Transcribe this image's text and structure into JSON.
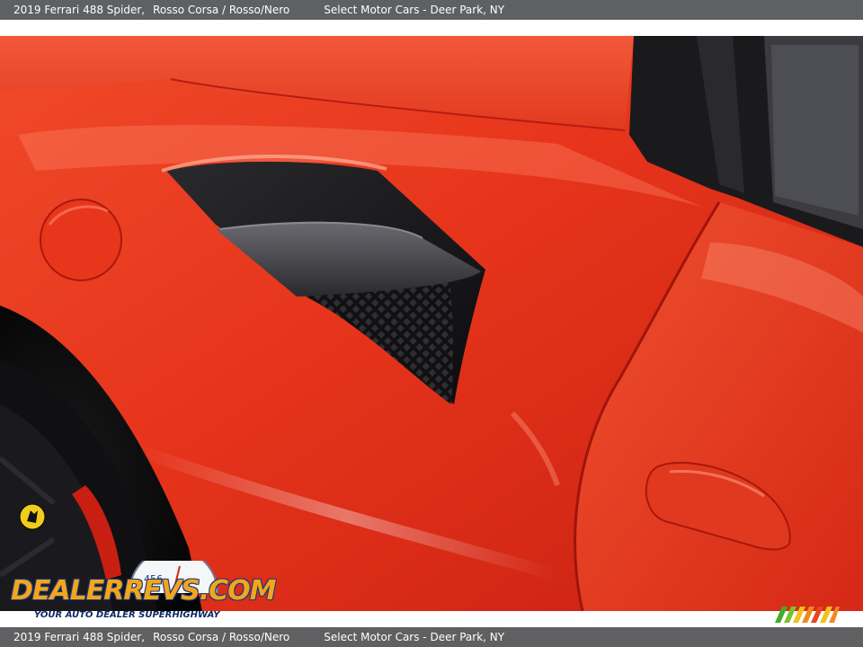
{
  "caption": {
    "title": "2019 Ferrari 488 Spider,",
    "colors": "Rosso Corsa / Rosso/Nero",
    "dealer": "Select Motor Cars - Deer Park, NY"
  },
  "photo": {
    "description_icon": "car-photo",
    "body_color": "#e8321a"
  },
  "watermark": {
    "logo_text": "DEALERREVS.COM",
    "tagline": "YOUR AUTO DEALER SUPERHIGHWAY",
    "gauge_digits": "456"
  },
  "colors": {
    "caption_bg": "#5f6062",
    "caption_text": "#ffffff",
    "logo_orange": "#f3a51c",
    "logo_blue": "#1c3a7a"
  }
}
